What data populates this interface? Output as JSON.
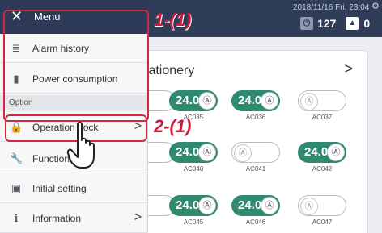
{
  "topbar": {
    "datetime": "2018/11/16 Fri. 23:04",
    "power_count": "127",
    "alarm_count": "0",
    "icons": [
      "gear-icon",
      "power-icon",
      "alarm-icon"
    ]
  },
  "panel": {
    "title": "tationery",
    "chevron": ">"
  },
  "units": [
    {
      "name": "",
      "temp": "",
      "on": false
    },
    {
      "name": "AC035",
      "temp": "24.0",
      "on": true
    },
    {
      "name": "AC036",
      "temp": "24.0",
      "on": true
    },
    {
      "name": "AC037",
      "temp": "",
      "on": false
    },
    {
      "name": "",
      "temp": "",
      "on": false
    },
    {
      "name": "AC040",
      "temp": "24.0",
      "on": true
    },
    {
      "name": "AC041",
      "temp": "",
      "on": false
    },
    {
      "name": "AC042",
      "temp": "24.0",
      "on": true
    },
    {
      "name": "",
      "temp": "",
      "on": false
    },
    {
      "name": "AC045",
      "temp": "24.0",
      "on": true
    },
    {
      "name": "AC046",
      "temp": "24.0",
      "on": true
    },
    {
      "name": "AC047",
      "temp": "",
      "on": false
    }
  ],
  "menu": {
    "title": "Menu",
    "close_glyph": "✕",
    "section_label": "Option",
    "items": [
      {
        "label": "Alarm history",
        "icon": "alarm-history-icon",
        "glyph": "≣"
      },
      {
        "label": "Power consumption",
        "icon": "power-consumption-icon",
        "glyph": "▮"
      },
      {
        "label": "Operation Lock",
        "icon": "lock-icon",
        "glyph": "🔒",
        "chevron": ">"
      },
      {
        "label": "Function",
        "icon": "wrench-icon",
        "glyph": "🔧"
      },
      {
        "label": "Initial setting",
        "icon": "settings-icon",
        "glyph": "▣"
      },
      {
        "label": "Information",
        "icon": "info-icon",
        "glyph": "ℹ",
        "chevron": ">"
      }
    ]
  },
  "annotations": {
    "step1": "1-(1)",
    "step2": "2-(1)",
    "accent_color": "#d11b3a"
  },
  "colors": {
    "header": "#2c3a58",
    "unit_on": "#2f8a6f"
  }
}
